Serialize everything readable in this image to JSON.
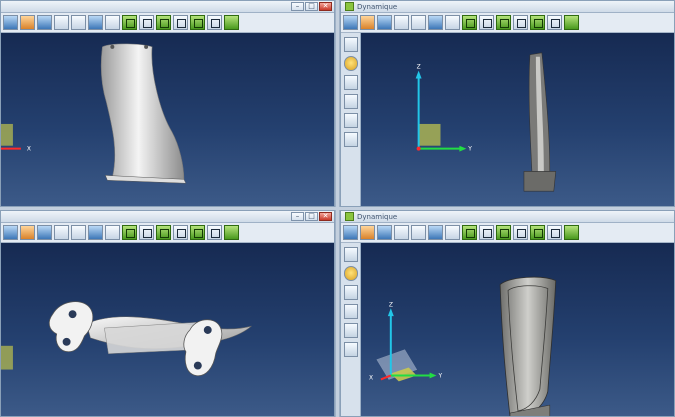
{
  "windows": {
    "top_right": {
      "title": "Dynamique"
    },
    "bottom_right": {
      "title": "Dynamique"
    }
  },
  "window_buttons": {
    "minimize": "–",
    "maximize": "□",
    "close": "✕"
  },
  "axes": {
    "x": "X",
    "y": "Y",
    "z": "Z"
  },
  "toolbar": {
    "icons": [
      "layers-icon",
      "tools-icon",
      "color-icon",
      "save-icon",
      "window-icon",
      "print-icon",
      "wrench-icon",
      "view-cube-icon",
      "view-cube-icon",
      "view-cube-icon",
      "view-cube-icon",
      "view-cube-icon",
      "view-cube-icon",
      "view-cube-green-icon"
    ]
  },
  "sidebar": {
    "icons": [
      "menu-icon",
      "face-icon",
      "cylinder-icon",
      "cylinder-icon",
      "cylinder-icon",
      "cylinder-icon"
    ]
  },
  "colors": {
    "viewport_top": "#162a52",
    "viewport_bottom": "#3c5a88",
    "axis_x": "#ff2a2a",
    "axis_y": "#22dd44",
    "axis_z": "#22c6e8",
    "origin_box": "#c8c850"
  }
}
